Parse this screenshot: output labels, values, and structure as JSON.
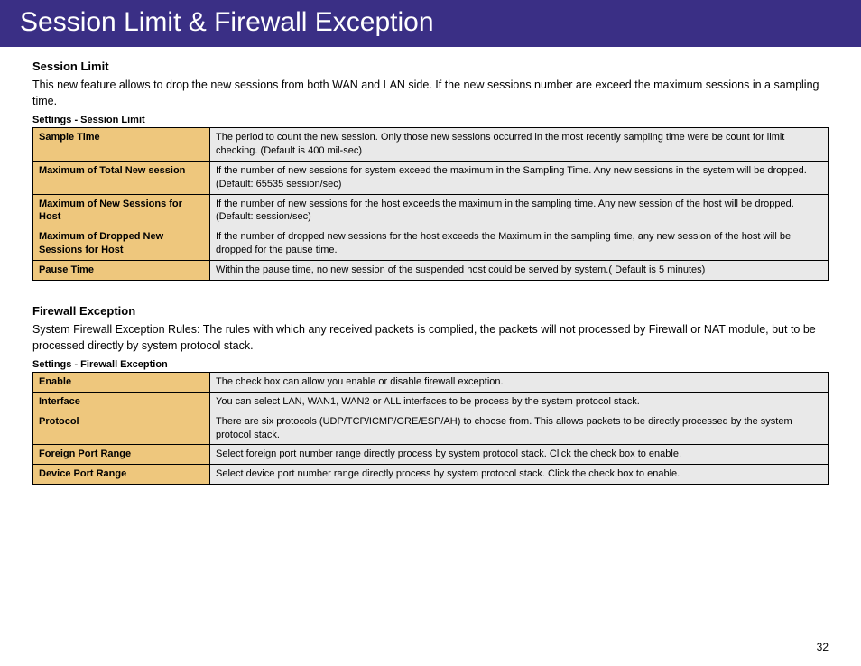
{
  "banner": {
    "title": "Session Limit & Firewall Exception"
  },
  "session_limit": {
    "heading": "Session Limit",
    "description": "This new feature allows to drop the new sessions from both WAN and LAN side. If the new sessions number are exceed the maximum sessions in a sampling time.",
    "table_caption": "Settings - Session Limit",
    "rows": [
      {
        "key": "Sample Time",
        "val": "The period to count the new session. Only those new sessions occurred in the most recently sampling time were be count for limit checking. (Default is 400 mil-sec)"
      },
      {
        "key": "Maximum of Total New session",
        "val": "If the number of new sessions for system exceed the maximum in the Sampling Time. Any new sessions in the system will be dropped. (Default: 65535 session/sec)"
      },
      {
        "key": "Maximum of New Sessions for Host",
        "val": "If the number of new sessions for the host exceeds the maximum in the sampling time. Any new session of the host will be dropped. (Default: session/sec)"
      },
      {
        "key": "Maximum of Dropped New Sessions for Host",
        "val": "If the number of dropped new sessions for the host exceeds the Maximum in the sampling time, any new session of the host will be dropped for the pause time."
      },
      {
        "key": "Pause Time",
        "val": "Within the pause time, no new session of the suspended host could be served by system.( Default is 5 minutes)"
      }
    ]
  },
  "firewall_exception": {
    "heading": "Firewall Exception",
    "description": "System Firewall Exception Rules: The rules with which any received packets is complied, the packets will not processed by Firewall or NAT module, but to be processed directly by system protocol stack.",
    "table_caption": "Settings - Firewall Exception",
    "rows": [
      {
        "key": "Enable",
        "val": "The check box can allow you enable or disable firewall exception."
      },
      {
        "key": "Interface",
        "val": "You can select LAN, WAN1, WAN2 or ALL interfaces to be process by the system protocol stack."
      },
      {
        "key": "Protocol",
        "val": "There are six protocols (UDP/TCP/ICMP/GRE/ESP/AH) to choose from. This allows packets to be directly processed by the system protocol stack."
      },
      {
        "key": "Foreign Port Range",
        "val": "Select foreign port number range directly process by system protocol stack. Click the check box to enable."
      },
      {
        "key": "Device Port Range",
        "val": "Select device port number range directly process by system protocol stack. Click the check box to enable."
      }
    ]
  },
  "page_number": "32"
}
